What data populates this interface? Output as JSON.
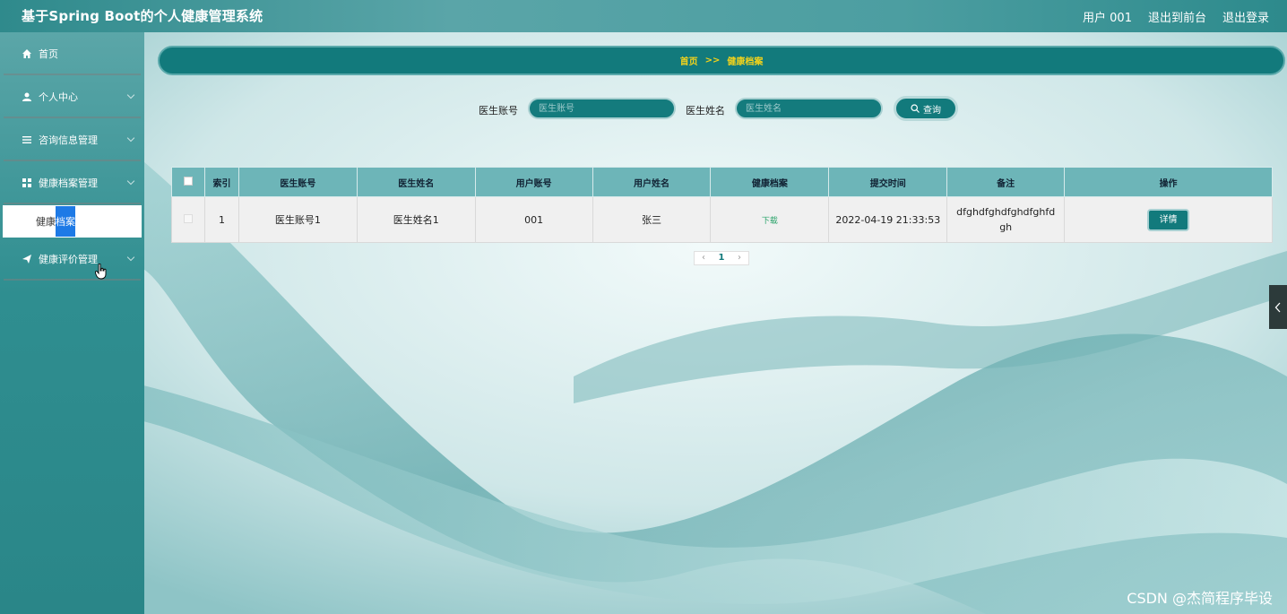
{
  "topbar": {
    "title": "基于Spring Boot的个人健康管理系统",
    "user": "用户 001",
    "back_to_front": "退出到前台",
    "logout": "退出登录"
  },
  "sidebar": {
    "items": [
      {
        "label": "首页",
        "icon": "home-icon"
      },
      {
        "label": "个人中心",
        "icon": "user-icon"
      },
      {
        "label": "咨询信息管理",
        "icon": "list-icon"
      },
      {
        "label": "健康档案管理",
        "icon": "grid-icon"
      },
      {
        "label": "健康评价管理",
        "icon": "send-icon"
      }
    ],
    "submenu": {
      "label_part1": "健康",
      "label_part2": "档案"
    }
  },
  "breadcrumb": {
    "home": "首页",
    "sep": ">>",
    "current": "健康档案"
  },
  "search": {
    "doctor_account_label": "医生账号",
    "doctor_account_placeholder": "医生账号",
    "doctor_name_label": "医生姓名",
    "doctor_name_placeholder": "医生姓名",
    "query_label": "查询"
  },
  "table": {
    "headers": [
      "索引",
      "医生账号",
      "医生姓名",
      "用户账号",
      "用户姓名",
      "健康档案",
      "提交时间",
      "备注",
      "操作"
    ],
    "rows": [
      {
        "index": "1",
        "doctor_account": "医生账号1",
        "doctor_name": "医生姓名1",
        "user_account": "001",
        "user_name": "张三",
        "health_file": "下载",
        "submit_time": "2022-04-19 21:33:53",
        "remark": "dfghdfghdfghdfghfdgh",
        "action": "详情"
      }
    ]
  },
  "pager": {
    "current": "1"
  },
  "watermark": "CSDN @杰简程序毕设",
  "colors": {
    "accent": "#127a7c",
    "highlight": "#f2d21b"
  }
}
